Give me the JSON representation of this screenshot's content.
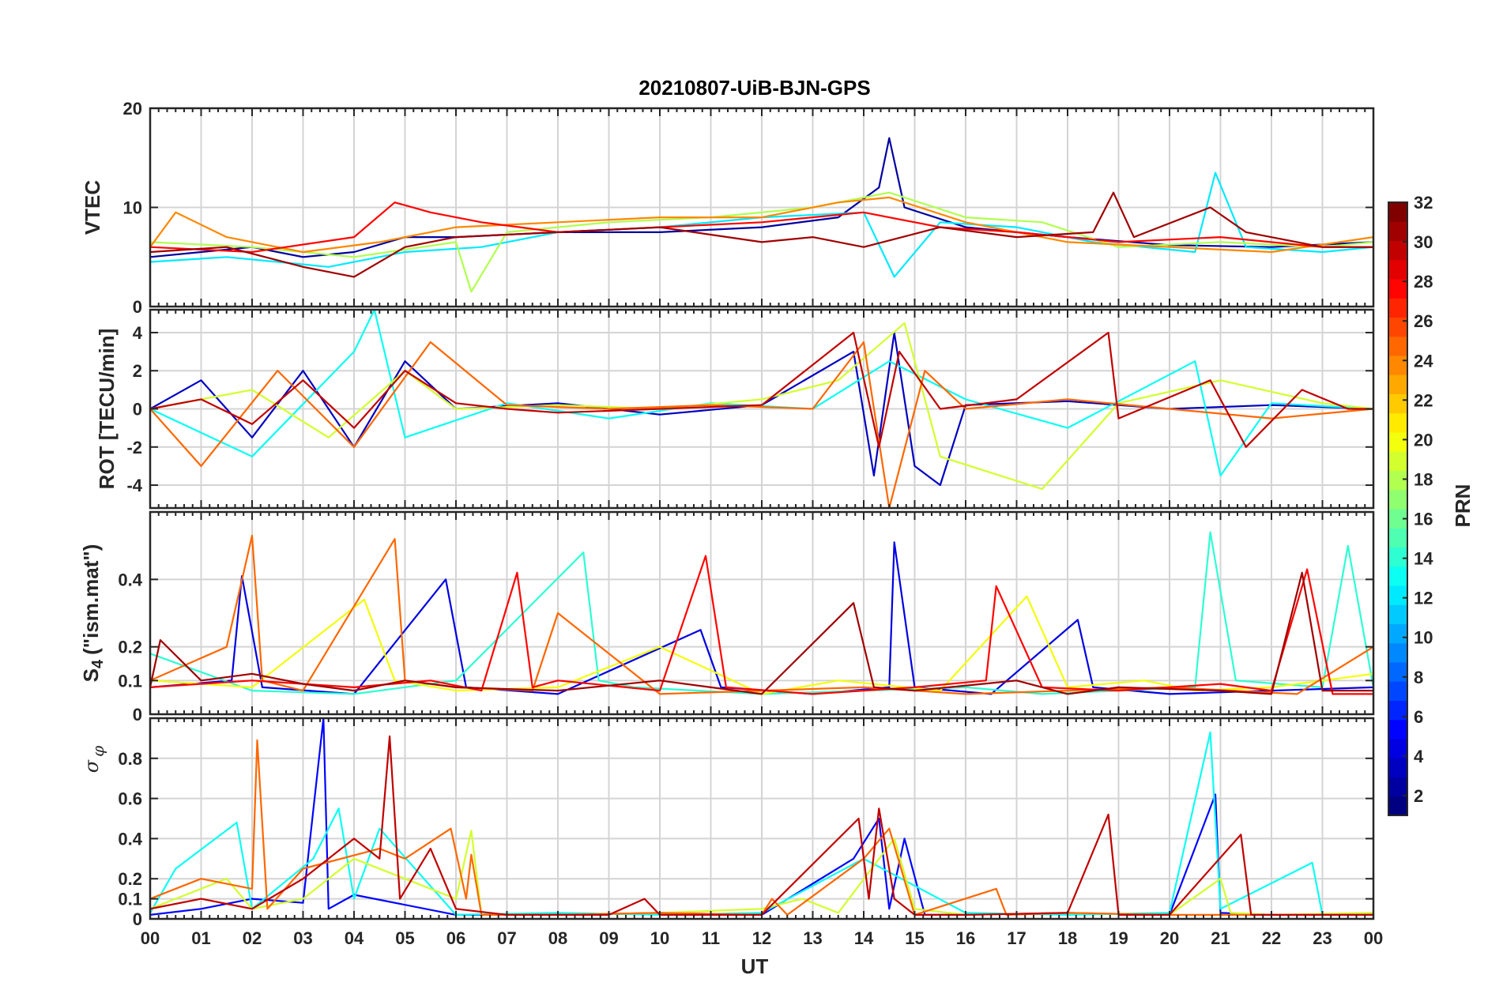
{
  "figure": {
    "title": "20210807-UiB-BJN-GPS",
    "xlabel": "UT",
    "colorbar_label": "PRN"
  },
  "chart_data": [
    {
      "type": "line",
      "panel": "vtec",
      "ylabel": "VTEC",
      "xlim": [
        0,
        24
      ],
      "ylim": [
        0,
        20
      ],
      "yticks": [
        0,
        10,
        20
      ],
      "grid": true,
      "xticklabels_visible": false,
      "series": [
        {
          "prn": 2,
          "x": [
            0.0,
            1.0,
            2.0,
            3.0,
            4.0,
            5.0,
            6.0,
            8.0,
            10.0,
            12.0,
            13.5,
            14.3,
            14.5,
            14.8,
            16.0,
            18.0,
            20.0,
            22.0,
            24.0
          ],
          "y": [
            5.0,
            5.5,
            6.0,
            5.0,
            5.5,
            7.0,
            7.0,
            7.5,
            7.5,
            8.0,
            9.0,
            12.0,
            17.0,
            10.0,
            8.0,
            7.0,
            6.2,
            6.0,
            6.5
          ]
        },
        {
          "prn": 12,
          "x": [
            0.0,
            1.5,
            2.5,
            3.5,
            5.0,
            6.5,
            8.0,
            10.0,
            12.0,
            14.0,
            14.6,
            15.5,
            17.0,
            18.5,
            20.5,
            20.9,
            21.5,
            23.0,
            24.0
          ],
          "y": [
            4.5,
            5.0,
            4.5,
            4.0,
            5.5,
            6.0,
            7.5,
            8.0,
            9.0,
            9.5,
            3.0,
            8.5,
            8.0,
            6.5,
            5.5,
            13.5,
            6.0,
            5.5,
            6.0
          ]
        },
        {
          "prn": 18,
          "x": [
            0.0,
            2.0,
            4.0,
            6.0,
            6.3,
            7.0,
            9.0,
            11.0,
            13.0,
            14.5,
            16.0,
            17.5,
            19.0,
            21.0,
            23.0,
            24.0
          ],
          "y": [
            6.5,
            6.0,
            5.0,
            6.5,
            1.5,
            7.5,
            8.5,
            9.0,
            10.0,
            11.5,
            9.0,
            8.5,
            6.0,
            6.5,
            6.0,
            6.5
          ]
        },
        {
          "prn": 24,
          "x": [
            0.0,
            0.5,
            1.5,
            3.0,
            4.5,
            6.0,
            8.0,
            10.0,
            12.0,
            13.5,
            14.5,
            16.0,
            18.0,
            20.0,
            22.0,
            24.0
          ],
          "y": [
            6.0,
            9.5,
            7.0,
            5.5,
            6.5,
            8.0,
            8.5,
            9.0,
            9.0,
            10.5,
            11.0,
            8.5,
            6.5,
            6.0,
            5.5,
            7.0
          ]
        },
        {
          "prn": 28,
          "x": [
            0.0,
            2.0,
            4.0,
            4.8,
            5.5,
            6.5,
            8.0,
            10.0,
            12.0,
            14.0,
            15.5,
            17.0,
            19.0,
            21.0,
            23.0,
            24.0
          ],
          "y": [
            6.0,
            5.5,
            7.0,
            10.5,
            9.5,
            8.5,
            7.5,
            8.0,
            8.5,
            9.5,
            8.0,
            7.5,
            6.5,
            7.0,
            6.0,
            6.0
          ]
        },
        {
          "prn": 31,
          "x": [
            0.0,
            1.5,
            3.0,
            4.0,
            5.0,
            6.0,
            8.0,
            10.0,
            12.0,
            13.0,
            14.0,
            15.5,
            17.0,
            18.5,
            18.9,
            19.3,
            20.8,
            21.5,
            23.0,
            24.0
          ],
          "y": [
            5.5,
            6.0,
            4.0,
            3.0,
            6.0,
            7.0,
            7.5,
            8.0,
            6.5,
            7.0,
            6.0,
            8.0,
            7.0,
            7.5,
            11.5,
            7.0,
            10.0,
            7.5,
            6.0,
            6.0
          ]
        }
      ]
    },
    {
      "type": "line",
      "panel": "rot",
      "ylabel": "ROT [TECU/min]",
      "xlim": [
        0,
        24
      ],
      "ylim": [
        -5.2,
        5.2
      ],
      "yticks": [
        -4,
        -2,
        0,
        2,
        4
      ],
      "grid": true,
      "xticklabels_visible": false,
      "series": [
        {
          "prn": 3,
          "x": [
            0.0,
            1.0,
            2.0,
            3.0,
            4.0,
            5.0,
            6.0,
            8.0,
            10.0,
            12.0,
            13.8,
            14.2,
            14.6,
            15.0,
            15.5,
            16.0,
            18.0,
            20.0,
            22.0,
            24.0
          ],
          "y": [
            0.0,
            1.5,
            -1.5,
            2.0,
            -2.0,
            2.5,
            0.0,
            0.3,
            -0.3,
            0.2,
            3.0,
            -3.5,
            4.0,
            -3.0,
            -4.0,
            0.2,
            0.4,
            0.0,
            0.2,
            0.0
          ]
        },
        {
          "prn": 13,
          "x": [
            0.0,
            2.0,
            4.0,
            4.4,
            5.0,
            7.0,
            9.0,
            11.0,
            13.0,
            14.5,
            16.0,
            18.0,
            20.5,
            21.0,
            22.0,
            24.0
          ],
          "y": [
            0.0,
            -2.5,
            3.0,
            5.2,
            -1.5,
            0.3,
            -0.5,
            0.3,
            0.0,
            2.5,
            0.5,
            -1.0,
            2.5,
            -3.5,
            0.3,
            0.0
          ]
        },
        {
          "prn": 19,
          "x": [
            0.0,
            2.0,
            3.5,
            5.0,
            6.0,
            8.0,
            10.0,
            12.0,
            13.5,
            14.8,
            15.5,
            17.5,
            19.0,
            21.0,
            23.0,
            24.0
          ],
          "y": [
            0.0,
            1.0,
            -1.5,
            2.0,
            0.0,
            0.2,
            0.0,
            0.5,
            1.5,
            4.5,
            -2.5,
            -4.2,
            0.3,
            1.5,
            0.3,
            0.0
          ]
        },
        {
          "prn": 25,
          "x": [
            0.0,
            1.0,
            2.5,
            4.0,
            5.5,
            7.0,
            9.0,
            11.0,
            13.0,
            14.0,
            14.5,
            15.2,
            16.0,
            18.0,
            20.0,
            22.0,
            24.0
          ],
          "y": [
            0.0,
            -3.0,
            2.0,
            -2.0,
            3.5,
            0.2,
            0.0,
            0.2,
            0.0,
            3.5,
            -5.2,
            2.0,
            0.0,
            0.5,
            0.0,
            -0.5,
            0.0
          ]
        },
        {
          "prn": 30,
          "x": [
            0.0,
            1.0,
            2.0,
            3.0,
            4.0,
            5.0,
            6.0,
            7.0,
            8.0,
            10.0,
            12.0,
            13.8,
            14.3,
            14.7,
            15.5,
            17.0,
            18.8,
            19.0,
            20.8,
            21.5,
            22.6,
            23.5,
            24.0
          ],
          "y": [
            0.0,
            0.5,
            -0.8,
            1.5,
            -1.0,
            2.0,
            0.3,
            0.0,
            -0.2,
            0.0,
            0.2,
            4.0,
            -2.0,
            3.0,
            0.0,
            0.5,
            4.0,
            -0.5,
            1.5,
            -2.0,
            1.0,
            0.0,
            0.0
          ]
        }
      ]
    },
    {
      "type": "line",
      "panel": "s4",
      "ylabel": "S4 (\"ism.mat\")",
      "xlim": [
        0,
        24
      ],
      "ylim": [
        0,
        0.6
      ],
      "yticks": [
        0,
        0.1,
        0.2,
        0.4
      ],
      "grid": true,
      "xticklabels_visible": false,
      "series": [
        {
          "prn": 4,
          "x": [
            0.0,
            1.6,
            1.8,
            2.2,
            4.0,
            5.8,
            6.2,
            8.0,
            10.8,
            11.2,
            13.0,
            14.5,
            14.6,
            15.0,
            16.5,
            18.2,
            18.5,
            20.0,
            22.0,
            24.0
          ],
          "y": [
            0.08,
            0.1,
            0.41,
            0.08,
            0.06,
            0.4,
            0.08,
            0.06,
            0.25,
            0.08,
            0.06,
            0.08,
            0.51,
            0.08,
            0.06,
            0.28,
            0.08,
            0.06,
            0.07,
            0.08
          ]
        },
        {
          "prn": 14,
          "x": [
            0.0,
            2.0,
            4.0,
            6.0,
            8.5,
            8.8,
            9.5,
            12.0,
            14.0,
            16.0,
            17.5,
            19.0,
            20.5,
            20.8,
            21.3,
            23.0,
            23.5,
            24.0
          ],
          "y": [
            0.18,
            0.07,
            0.06,
            0.1,
            0.48,
            0.1,
            0.08,
            0.06,
            0.07,
            0.08,
            0.06,
            0.07,
            0.08,
            0.54,
            0.1,
            0.08,
            0.5,
            0.08
          ]
        },
        {
          "prn": 20,
          "x": [
            0.0,
            2.0,
            4.2,
            4.8,
            6.0,
            8.0,
            10.0,
            12.0,
            13.5,
            15.5,
            17.2,
            18.0,
            19.5,
            20.5,
            22.0,
            24.0
          ],
          "y": [
            0.1,
            0.08,
            0.34,
            0.1,
            0.07,
            0.08,
            0.2,
            0.06,
            0.1,
            0.07,
            0.35,
            0.08,
            0.1,
            0.07,
            0.08,
            0.12
          ]
        },
        {
          "prn": 25,
          "x": [
            0.0,
            1.5,
            2.0,
            2.2,
            3.0,
            4.8,
            5.0,
            6.0,
            7.5,
            8.0,
            10.0,
            12.0,
            14.0,
            16.0,
            18.0,
            20.0,
            22.5,
            24.0
          ],
          "y": [
            0.1,
            0.2,
            0.53,
            0.1,
            0.07,
            0.52,
            0.1,
            0.08,
            0.07,
            0.3,
            0.06,
            0.07,
            0.08,
            0.06,
            0.07,
            0.08,
            0.06,
            0.2
          ]
        },
        {
          "prn": 28,
          "x": [
            0.0,
            2.0,
            4.0,
            5.5,
            6.5,
            7.2,
            7.5,
            8.0,
            10.0,
            10.9,
            11.3,
            13.0,
            15.0,
            16.4,
            16.6,
            17.5,
            19.0,
            21.0,
            22.0,
            22.7,
            23.2,
            24.0
          ],
          "y": [
            0.08,
            0.1,
            0.08,
            0.1,
            0.07,
            0.42,
            0.08,
            0.1,
            0.07,
            0.47,
            0.08,
            0.06,
            0.08,
            0.1,
            0.38,
            0.08,
            0.07,
            0.09,
            0.07,
            0.43,
            0.06,
            0.06
          ]
        },
        {
          "prn": 31,
          "x": [
            0.0,
            0.2,
            1.0,
            2.0,
            3.0,
            4.0,
            5.0,
            6.0,
            8.0,
            10.0,
            12.0,
            13.8,
            14.2,
            15.0,
            17.0,
            18.0,
            19.0,
            21.0,
            22.0,
            22.6,
            23.0,
            24.0
          ],
          "y": [
            0.08,
            0.22,
            0.1,
            0.12,
            0.09,
            0.07,
            0.1,
            0.08,
            0.07,
            0.1,
            0.06,
            0.33,
            0.08,
            0.07,
            0.1,
            0.06,
            0.08,
            0.07,
            0.06,
            0.42,
            0.07,
            0.07
          ]
        }
      ]
    },
    {
      "type": "line",
      "panel": "sigma_phi",
      "ylabel": "σ φ",
      "xlim": [
        0,
        24
      ],
      "ylim": [
        0,
        1
      ],
      "yticks": [
        0,
        0.1,
        0.2,
        0.4,
        0.6,
        0.8
      ],
      "grid": true,
      "xticklabels_visible": true,
      "xticks": [
        0,
        1,
        2,
        3,
        4,
        5,
        6,
        7,
        8,
        9,
        10,
        11,
        12,
        13,
        14,
        15,
        16,
        17,
        18,
        19,
        20,
        21,
        22,
        23,
        24
      ],
      "xticklabels": [
        "00",
        "01",
        "02",
        "03",
        "04",
        "05",
        "06",
        "07",
        "08",
        "09",
        "10",
        "11",
        "12",
        "13",
        "14",
        "15",
        "16",
        "17",
        "18",
        "19",
        "20",
        "21",
        "22",
        "23",
        "00"
      ],
      "series": [
        {
          "prn": 5,
          "x": [
            0.0,
            1.0,
            2.0,
            3.0,
            3.4,
            3.5,
            4.0,
            6.0,
            8.0,
            10.0,
            12.0,
            13.8,
            14.3,
            14.5,
            14.8,
            15.2,
            16.0,
            18.0,
            20.0,
            20.9,
            21.0,
            22.0,
            24.0
          ],
          "y": [
            0.02,
            0.05,
            0.1,
            0.08,
            1.0,
            0.05,
            0.12,
            0.02,
            0.02,
            0.03,
            0.02,
            0.3,
            0.5,
            0.05,
            0.4,
            0.02,
            0.02,
            0.03,
            0.02,
            0.62,
            0.03,
            0.02,
            0.02
          ]
        },
        {
          "prn": 13,
          "x": [
            0.0,
            0.5,
            1.7,
            2.0,
            3.2,
            3.7,
            4.0,
            4.5,
            6.0,
            8.0,
            10.0,
            12.0,
            14.0,
            16.0,
            18.0,
            20.0,
            20.8,
            21.0,
            22.8,
            23.0,
            24.0
          ],
          "y": [
            0.03,
            0.25,
            0.48,
            0.05,
            0.3,
            0.55,
            0.1,
            0.45,
            0.02,
            0.03,
            0.02,
            0.03,
            0.3,
            0.03,
            0.02,
            0.03,
            0.93,
            0.05,
            0.28,
            0.02,
            0.02
          ]
        },
        {
          "prn": 19,
          "x": [
            0.0,
            1.5,
            2.0,
            3.0,
            4.0,
            5.0,
            6.0,
            6.3,
            6.5,
            8.0,
            10.0,
            12.0,
            12.8,
            13.5,
            14.6,
            15.0,
            16.0,
            18.0,
            20.0,
            21.0,
            21.2,
            22.0,
            24.0
          ],
          "y": [
            0.05,
            0.2,
            0.05,
            0.1,
            0.3,
            0.2,
            0.1,
            0.44,
            0.02,
            0.02,
            0.03,
            0.05,
            0.1,
            0.03,
            0.4,
            0.05,
            0.02,
            0.03,
            0.02,
            0.2,
            0.03,
            0.02,
            0.03
          ]
        },
        {
          "prn": 25,
          "x": [
            0.0,
            1.0,
            2.0,
            2.1,
            2.3,
            3.0,
            4.5,
            5.0,
            5.9,
            6.2,
            6.3,
            6.5,
            8.0,
            10.0,
            12.0,
            12.2,
            12.5,
            14.0,
            14.5,
            15.0,
            16.6,
            16.8,
            18.0,
            20.0,
            22.0,
            24.0
          ],
          "y": [
            0.1,
            0.2,
            0.15,
            0.89,
            0.05,
            0.25,
            0.35,
            0.3,
            0.45,
            0.1,
            0.32,
            0.02,
            0.02,
            0.03,
            0.02,
            0.1,
            0.02,
            0.3,
            0.45,
            0.02,
            0.15,
            0.02,
            0.03,
            0.02,
            0.02,
            0.02
          ]
        },
        {
          "prn": 30,
          "x": [
            0.0,
            1.0,
            2.0,
            3.0,
            3.5,
            4.0,
            4.5,
            4.7,
            4.9,
            5.5,
            6.0,
            7.0,
            9.0,
            9.7,
            10.0,
            12.0,
            13.9,
            14.1,
            14.3,
            14.6,
            15.0,
            16.0,
            18.0,
            18.8,
            19.0,
            20.0,
            21.4,
            21.6,
            22.0,
            24.0
          ],
          "y": [
            0.05,
            0.1,
            0.05,
            0.2,
            0.3,
            0.4,
            0.3,
            0.91,
            0.1,
            0.35,
            0.05,
            0.02,
            0.02,
            0.1,
            0.02,
            0.02,
            0.5,
            0.1,
            0.55,
            0.1,
            0.02,
            0.02,
            0.03,
            0.52,
            0.02,
            0.02,
            0.42,
            0.02,
            0.02,
            0.02
          ]
        }
      ]
    }
  ],
  "colorbar": {
    "label": "PRN",
    "range": [
      1,
      32
    ],
    "ticks": [
      2,
      4,
      6,
      8,
      10,
      12,
      14,
      16,
      18,
      20,
      22,
      24,
      26,
      28,
      30,
      32
    ],
    "colormap": "jet"
  }
}
